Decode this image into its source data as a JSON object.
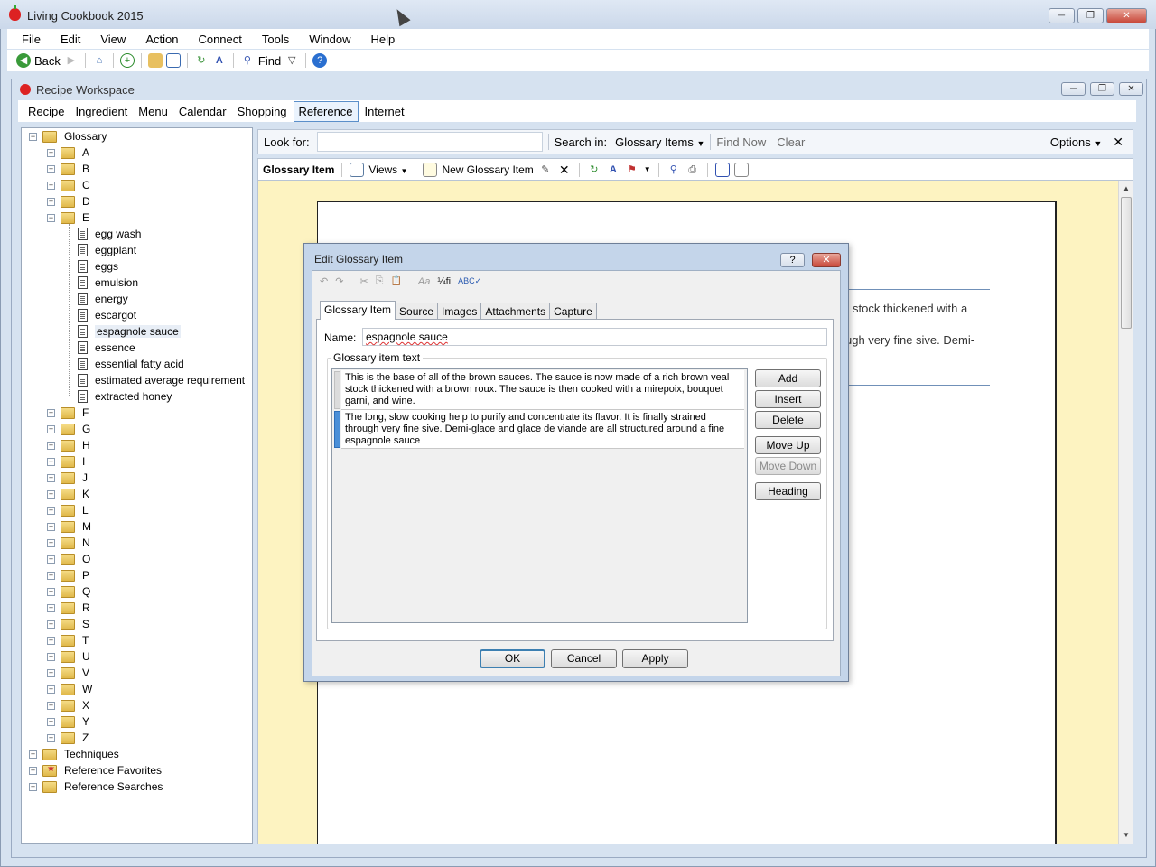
{
  "app": {
    "title": "Living Cookbook 2015",
    "window_buttons": [
      "─",
      "❐",
      "✕"
    ]
  },
  "menubar": [
    "File",
    "Edit",
    "View",
    "Action",
    "Connect",
    "Tools",
    "Window",
    "Help"
  ],
  "toolbar": {
    "back_label": "Back",
    "find_label": "Find"
  },
  "workspace": {
    "title": "Recipe Workspace",
    "tabs": [
      "Recipe",
      "Ingredient",
      "Menu",
      "Calendar",
      "Shopping",
      "Reference",
      "Internet"
    ],
    "active_tab": "Reference"
  },
  "tree": {
    "root": "Glossary",
    "letters_before": [
      "A",
      "B",
      "C",
      "D"
    ],
    "open_letter": "E",
    "e_items": [
      "egg wash",
      "eggplant",
      "eggs",
      "emulsion",
      "energy",
      "escargot",
      "espagnole sauce",
      "essence",
      "essential fatty acid",
      "estimated average requirement",
      "extracted honey"
    ],
    "selected_item": "espagnole sauce",
    "letters_after": [
      "F",
      "G",
      "H",
      "I",
      "J",
      "K",
      "L",
      "M",
      "N",
      "O",
      "P",
      "Q",
      "R",
      "S",
      "T",
      "U",
      "V",
      "W",
      "X",
      "Y",
      "Z"
    ],
    "other_roots": [
      "Techniques",
      "Reference Favorites",
      "Reference Searches"
    ]
  },
  "search": {
    "look_for_label": "Look for:",
    "look_for_value": "",
    "search_in_label": "Search in:",
    "search_in_value": "Glossary Items",
    "find_now": "Find Now",
    "clear": "Clear",
    "options": "Options"
  },
  "content_toolbar": {
    "title": "Glossary Item",
    "views": "Views",
    "new_item": "New Glossary Item"
  },
  "page": {
    "line1": "stock thickened with a",
    "line2": "ugh very fine sive. Demi-"
  },
  "dialog": {
    "title": "Edit Glossary Item",
    "help": "?",
    "close": "✕",
    "tabs": [
      "Glossary Item",
      "Source",
      "Images",
      "Attachments",
      "Capture"
    ],
    "active_tab": "Glossary Item",
    "name_label": "Name:",
    "name_value": "espagnole sauce",
    "group_label": "Glossary item text",
    "paragraphs": [
      "This is the base of all of the brown sauces. The sauce is now made of a rich brown veal stock thickened with a brown roux. The sauce is then cooked with a mirepoix, bouquet garni, and wine.",
      "The long, slow cooking help to purify and concentrate its flavor. It is finally strained through very fine sive. Demi-glace and glace de viande are all structured around a fine espagnole sauce"
    ],
    "side_buttons": [
      "Add",
      "Insert",
      "Delete",
      "Move Up",
      "Move Down",
      "Heading"
    ],
    "ok": "OK",
    "cancel": "Cancel",
    "apply": "Apply",
    "toolbar_glyphs": [
      "↶",
      "↷",
      "✂",
      "⎘",
      "📋",
      "Aa",
      "¼fi",
      "ABC✓"
    ]
  },
  "colors": {
    "content_bg": "#fdf3c1",
    "selection_blue": "#4a8fd8",
    "title_bar": "#d6e2f0"
  }
}
